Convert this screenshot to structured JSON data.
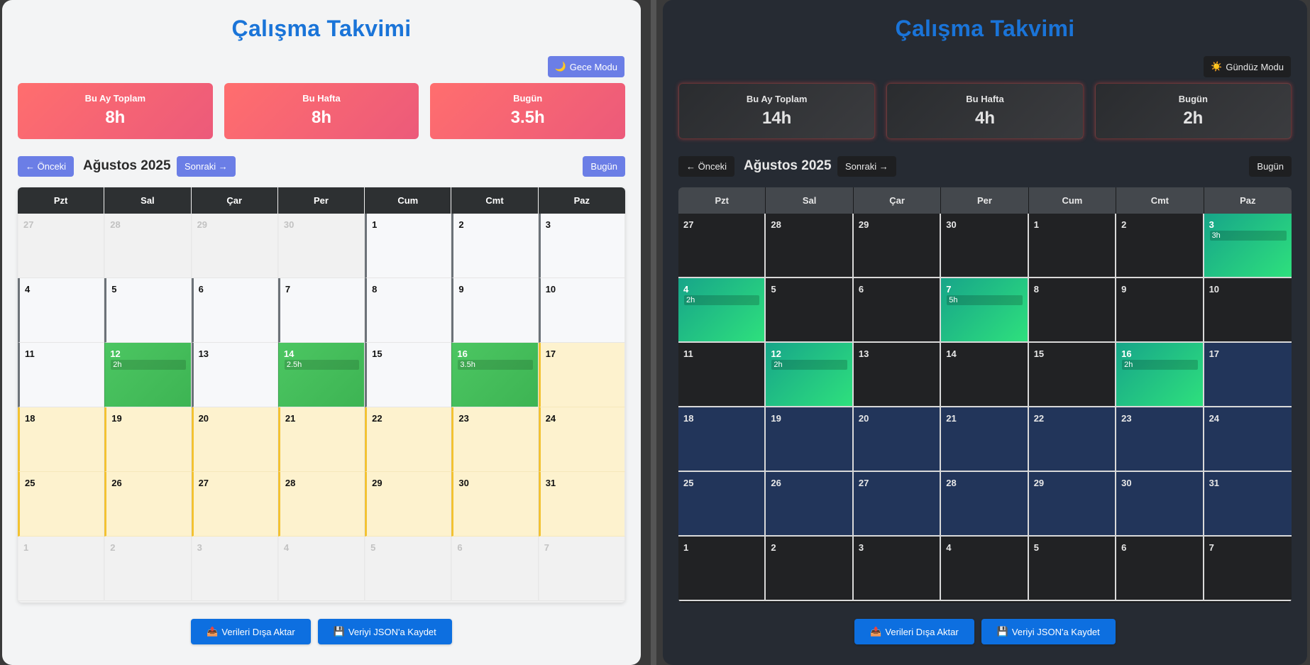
{
  "light": {
    "title": "Çalışma Takvimi",
    "mode_button": {
      "icon": "moon-icon",
      "glyph": "🌙",
      "label": "Gece Modu"
    },
    "stats": [
      {
        "label": "Bu Ay Toplam",
        "value": "8h"
      },
      {
        "label": "Bu Hafta",
        "value": "8h"
      },
      {
        "label": "Bugün",
        "value": "3.5h"
      }
    ],
    "nav": {
      "prev": "← Önceki",
      "month": "Ağustos 2025",
      "next": "Sonraki →",
      "today": "Bugün"
    },
    "weekdays": [
      "Pzt",
      "Sal",
      "Çar",
      "Per",
      "Cum",
      "Cmt",
      "Paz"
    ],
    "days": [
      {
        "d": "27",
        "t": "other"
      },
      {
        "d": "28",
        "t": "other"
      },
      {
        "d": "29",
        "t": "other"
      },
      {
        "d": "30",
        "t": "other"
      },
      {
        "d": "1",
        "t": "past"
      },
      {
        "d": "2",
        "t": "past"
      },
      {
        "d": "3",
        "t": "past"
      },
      {
        "d": "4",
        "t": "past"
      },
      {
        "d": "5",
        "t": "past"
      },
      {
        "d": "6",
        "t": "past"
      },
      {
        "d": "7",
        "t": "past"
      },
      {
        "d": "8",
        "t": "past"
      },
      {
        "d": "9",
        "t": "past"
      },
      {
        "d": "10",
        "t": "past"
      },
      {
        "d": "11",
        "t": "past"
      },
      {
        "d": "12",
        "t": "work",
        "h": "2h"
      },
      {
        "d": "13",
        "t": "past"
      },
      {
        "d": "14",
        "t": "work",
        "h": "2.5h"
      },
      {
        "d": "15",
        "t": "past"
      },
      {
        "d": "16",
        "t": "work",
        "h": "3.5h"
      },
      {
        "d": "17",
        "t": "future"
      },
      {
        "d": "18",
        "t": "future"
      },
      {
        "d": "19",
        "t": "future"
      },
      {
        "d": "20",
        "t": "future"
      },
      {
        "d": "21",
        "t": "future"
      },
      {
        "d": "22",
        "t": "future"
      },
      {
        "d": "23",
        "t": "future"
      },
      {
        "d": "24",
        "t": "future"
      },
      {
        "d": "25",
        "t": "future"
      },
      {
        "d": "26",
        "t": "future"
      },
      {
        "d": "27",
        "t": "future"
      },
      {
        "d": "28",
        "t": "future"
      },
      {
        "d": "29",
        "t": "future"
      },
      {
        "d": "30",
        "t": "future"
      },
      {
        "d": "31",
        "t": "future"
      },
      {
        "d": "1",
        "t": "other"
      },
      {
        "d": "2",
        "t": "other"
      },
      {
        "d": "3",
        "t": "other"
      },
      {
        "d": "4",
        "t": "other"
      },
      {
        "d": "5",
        "t": "other"
      },
      {
        "d": "6",
        "t": "other"
      },
      {
        "d": "7",
        "t": "other"
      }
    ],
    "actions": [
      {
        "icon": "outbox-icon",
        "glyph": "📤",
        "label": "Verileri Dışa Aktar"
      },
      {
        "icon": "floppy-disk-icon",
        "glyph": "💾",
        "label": "Veriyi JSON'a Kaydet"
      }
    ]
  },
  "dark": {
    "title": "Çalışma Takvimi",
    "mode_button": {
      "icon": "sun-icon",
      "glyph": "☀️",
      "label": "Gündüz Modu"
    },
    "stats": [
      {
        "label": "Bu Ay Toplam",
        "value": "14h"
      },
      {
        "label": "Bu Hafta",
        "value": "4h"
      },
      {
        "label": "Bugün",
        "value": "2h"
      }
    ],
    "nav": {
      "prev": "← Önceki",
      "month": "Ağustos 2025",
      "next": "Sonraki →",
      "today": "Bugün"
    },
    "weekdays": [
      "Pzt",
      "Sal",
      "Çar",
      "Per",
      "Cum",
      "Cmt",
      "Paz"
    ],
    "days": [
      {
        "d": "27",
        "t": "other"
      },
      {
        "d": "28",
        "t": "other"
      },
      {
        "d": "29",
        "t": "other"
      },
      {
        "d": "30",
        "t": "other"
      },
      {
        "d": "1",
        "t": "past"
      },
      {
        "d": "2",
        "t": "past"
      },
      {
        "d": "3",
        "t": "work",
        "h": "3h"
      },
      {
        "d": "4",
        "t": "work",
        "h": "2h"
      },
      {
        "d": "5",
        "t": "past"
      },
      {
        "d": "6",
        "t": "past"
      },
      {
        "d": "7",
        "t": "work",
        "h": "5h"
      },
      {
        "d": "8",
        "t": "past"
      },
      {
        "d": "9",
        "t": "past"
      },
      {
        "d": "10",
        "t": "past"
      },
      {
        "d": "11",
        "t": "past"
      },
      {
        "d": "12",
        "t": "work",
        "h": "2h"
      },
      {
        "d": "13",
        "t": "past"
      },
      {
        "d": "14",
        "t": "past"
      },
      {
        "d": "15",
        "t": "past"
      },
      {
        "d": "16",
        "t": "work",
        "h": "2h"
      },
      {
        "d": "17",
        "t": "future"
      },
      {
        "d": "18",
        "t": "future"
      },
      {
        "d": "19",
        "t": "future"
      },
      {
        "d": "20",
        "t": "future"
      },
      {
        "d": "21",
        "t": "future"
      },
      {
        "d": "22",
        "t": "future"
      },
      {
        "d": "23",
        "t": "future"
      },
      {
        "d": "24",
        "t": "future"
      },
      {
        "d": "25",
        "t": "future"
      },
      {
        "d": "26",
        "t": "future"
      },
      {
        "d": "27",
        "t": "future"
      },
      {
        "d": "28",
        "t": "future"
      },
      {
        "d": "29",
        "t": "future"
      },
      {
        "d": "30",
        "t": "future"
      },
      {
        "d": "31",
        "t": "future"
      },
      {
        "d": "1",
        "t": "other"
      },
      {
        "d": "2",
        "t": "other"
      },
      {
        "d": "3",
        "t": "other"
      },
      {
        "d": "4",
        "t": "other"
      },
      {
        "d": "5",
        "t": "other"
      },
      {
        "d": "6",
        "t": "other"
      },
      {
        "d": "7",
        "t": "other"
      }
    ],
    "actions": [
      {
        "icon": "outbox-icon",
        "glyph": "📤",
        "label": "Verileri Dışa Aktar"
      },
      {
        "icon": "floppy-disk-icon",
        "glyph": "💾",
        "label": "Veriyi JSON'a Kaydet"
      }
    ]
  },
  "colors": {
    "title_blue": "#1a74d8",
    "light_stat_red": "#ff6e6e",
    "work_green": "#4cc662",
    "dark_work_teal": "#17a589",
    "future_yellow": "#fdf2ce",
    "dark_future_navy": "#22355a",
    "action_blue": "#0d6fe0"
  }
}
